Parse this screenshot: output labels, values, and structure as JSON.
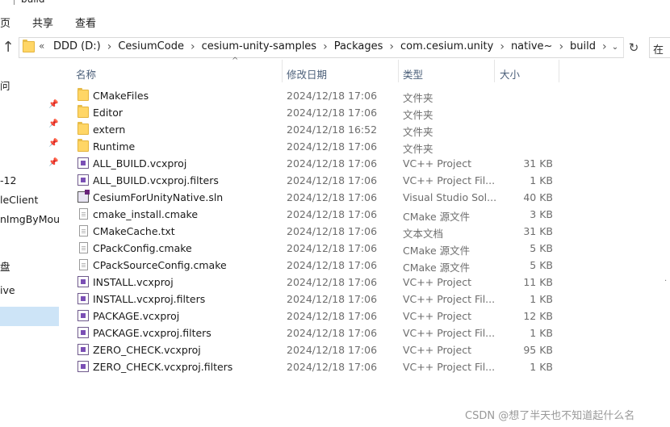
{
  "window": {
    "title": "build"
  },
  "ribbon": {
    "tabs": [
      "页",
      "共享",
      "查看"
    ]
  },
  "address": {
    "more": "«",
    "crumbs": [
      "DDD (D:)",
      "CesiumCode",
      "cesium-unity-samples",
      "Packages",
      "com.cesium.unity",
      "native~",
      "build"
    ],
    "refresh_icon": "refresh-icon",
    "dropdown_icon": "chevron-down-icon"
  },
  "search": {
    "placeholder": "在"
  },
  "nav": {
    "items": [
      {
        "label": "问",
        "pinned": false
      },
      {
        "label": "",
        "pinned": true
      },
      {
        "label": "",
        "pinned": true
      },
      {
        "label": "",
        "pinned": true
      },
      {
        "label": "",
        "pinned": true
      },
      {
        "label": "-12",
        "pinned": false
      },
      {
        "label": "leClient",
        "pinned": false
      },
      {
        "label": "nImgByMous",
        "pinned": false
      },
      {
        "label": "盘",
        "pinned": false
      },
      {
        "label": "ive",
        "pinned": false
      },
      {
        "label": "",
        "pinned": false,
        "selected": true
      }
    ]
  },
  "columns": {
    "name": "名称",
    "date": "修改日期",
    "type": "类型",
    "size": "大小"
  },
  "files": [
    {
      "name": "CMakeFiles",
      "date": "2024/12/18 17:06",
      "type": "文件夹",
      "size": "",
      "icon": "folder-icon"
    },
    {
      "name": "Editor",
      "date": "2024/12/18 17:06",
      "type": "文件夹",
      "size": "",
      "icon": "folder-icon"
    },
    {
      "name": "extern",
      "date": "2024/12/18 16:52",
      "type": "文件夹",
      "size": "",
      "icon": "folder-icon"
    },
    {
      "name": "Runtime",
      "date": "2024/12/18 17:06",
      "type": "文件夹",
      "size": "",
      "icon": "folder-icon"
    },
    {
      "name": "ALL_BUILD.vcxproj",
      "date": "2024/12/18 17:06",
      "type": "VC++ Project",
      "size": "31 KB",
      "icon": "vcxproj-icon"
    },
    {
      "name": "ALL_BUILD.vcxproj.filters",
      "date": "2024/12/18 17:06",
      "type": "VC++ Project Fil...",
      "size": "1 KB",
      "icon": "vcxproj-icon"
    },
    {
      "name": "CesiumForUnityNative.sln",
      "date": "2024/12/18 17:06",
      "type": "Visual Studio Sol...",
      "size": "40 KB",
      "icon": "solution-icon"
    },
    {
      "name": "cmake_install.cmake",
      "date": "2024/12/18 17:06",
      "type": "CMake 源文件",
      "size": "3 KB",
      "icon": "document-icon"
    },
    {
      "name": "CMakeCache.txt",
      "date": "2024/12/18 17:06",
      "type": "文本文档",
      "size": "31 KB",
      "icon": "document-icon"
    },
    {
      "name": "CPackConfig.cmake",
      "date": "2024/12/18 17:06",
      "type": "CMake 源文件",
      "size": "5 KB",
      "icon": "document-icon"
    },
    {
      "name": "CPackSourceConfig.cmake",
      "date": "2024/12/18 17:06",
      "type": "CMake 源文件",
      "size": "5 KB",
      "icon": "document-icon"
    },
    {
      "name": "INSTALL.vcxproj",
      "date": "2024/12/18 17:06",
      "type": "VC++ Project",
      "size": "11 KB",
      "icon": "vcxproj-icon"
    },
    {
      "name": "INSTALL.vcxproj.filters",
      "date": "2024/12/18 17:06",
      "type": "VC++ Project Fil...",
      "size": "1 KB",
      "icon": "vcxproj-icon"
    },
    {
      "name": "PACKAGE.vcxproj",
      "date": "2024/12/18 17:06",
      "type": "VC++ Project",
      "size": "12 KB",
      "icon": "vcxproj-icon"
    },
    {
      "name": "PACKAGE.vcxproj.filters",
      "date": "2024/12/18 17:06",
      "type": "VC++ Project Fil...",
      "size": "1 KB",
      "icon": "vcxproj-icon"
    },
    {
      "name": "ZERO_CHECK.vcxproj",
      "date": "2024/12/18 17:06",
      "type": "VC++ Project",
      "size": "95 KB",
      "icon": "vcxproj-icon"
    },
    {
      "name": "ZERO_CHECK.vcxproj.filters",
      "date": "2024/12/18 17:06",
      "type": "VC++ Project Fil...",
      "size": "1 KB",
      "icon": "vcxproj-icon"
    }
  ],
  "watermark": "CSDN @想了半天也不知道起什么名",
  "colors": {
    "accent_selected": "#cde4f7",
    "folder": "#ffd666",
    "header_text": "#4c607a"
  }
}
